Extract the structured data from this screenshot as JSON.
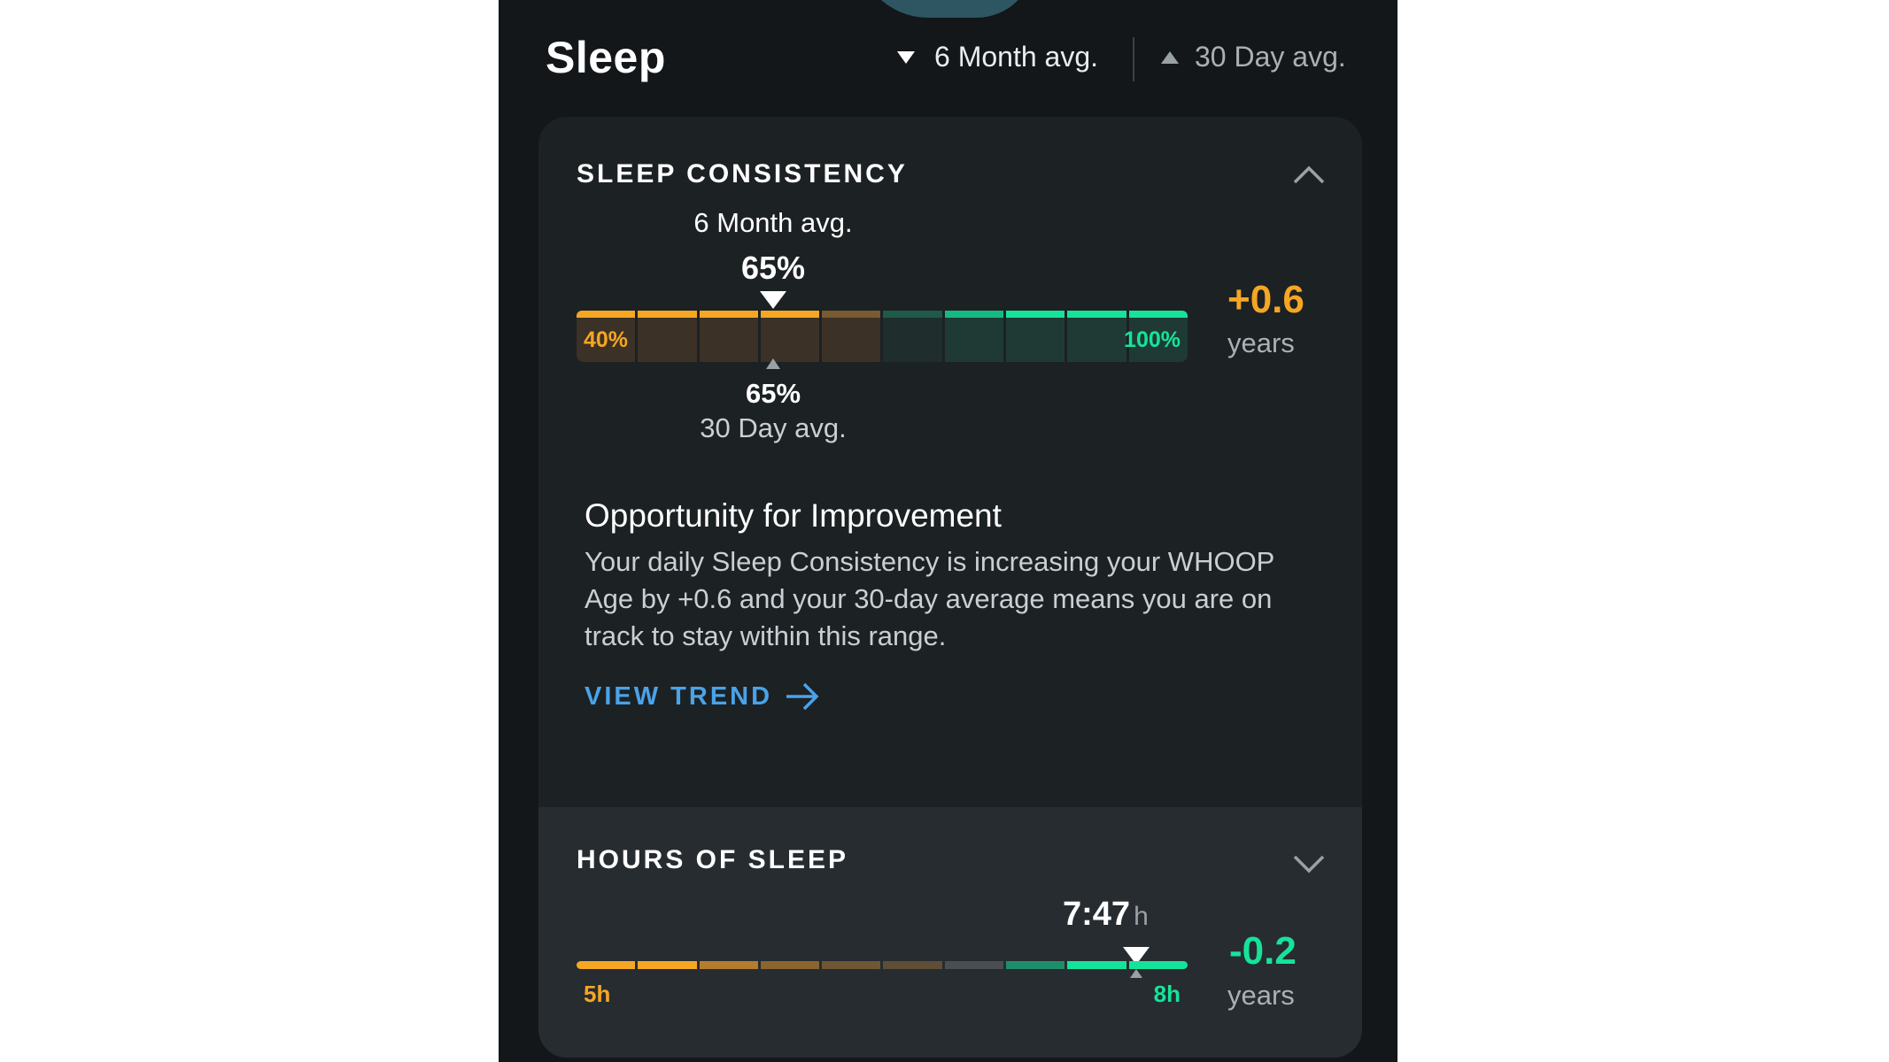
{
  "header": {
    "title": "Sleep",
    "legend_6m": "6 Month avg.",
    "legend_30d": "30 Day avg."
  },
  "sleep_consistency": {
    "title": "SLEEP CONSISTENCY",
    "six_month_label": "6 Month avg.",
    "six_month_value": "65%",
    "thirty_day_value": "65%",
    "thirty_day_label": "30 Day avg.",
    "bar_min_label": "40%",
    "bar_max_label": "100%",
    "marker_position_fraction": 0.417,
    "delta": "+0.6",
    "delta_unit": "years",
    "delta_color": "#f5a623",
    "opportunity_title": "Opportunity for Improvement",
    "opportunity_text": "Your daily Sleep Consistency is increasing your WHOOP Age by +0.6 and your 30-day average means you are on track to stay within this range.",
    "view_trend": "VIEW TREND"
  },
  "hours_of_sleep": {
    "title": "HOURS OF SLEEP",
    "value": "7:47",
    "value_unit": "h",
    "bar_min_label": "5h",
    "bar_max_label": "8h",
    "marker_position_fraction": 0.92,
    "delta": "-0.2",
    "delta_unit": "years",
    "delta_color": "#16e39a"
  },
  "colors": {
    "orange": "#f5a623",
    "green": "#16e39a",
    "link": "#4aa3e8"
  }
}
